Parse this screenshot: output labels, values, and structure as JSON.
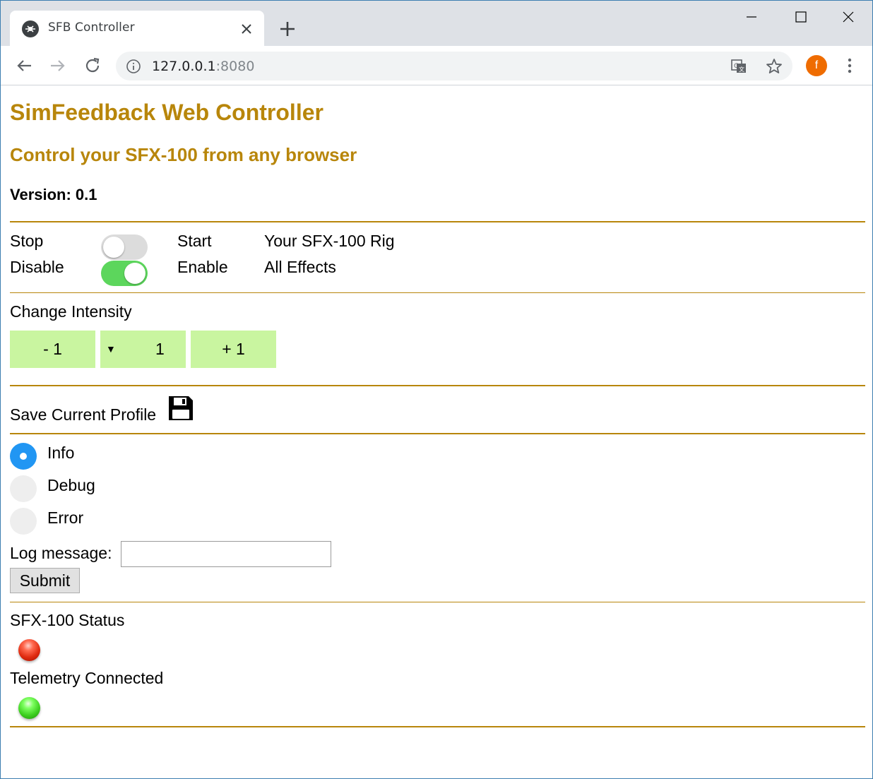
{
  "browser": {
    "tab_title": "SFB Controller",
    "url_host": "127.0.0.1",
    "url_port": ":8080",
    "profile_initial": "f"
  },
  "page": {
    "title": "SimFeedback Web Controller",
    "subtitle": "Control your SFX-100 from any browser",
    "version": "Version: 0.1",
    "rig_row": {
      "off_label": "Stop",
      "on_label": "Start",
      "target": "Your SFX-100 Rig",
      "toggle_on": false
    },
    "effects_row": {
      "off_label": "Disable",
      "on_label": "Enable",
      "target": "All Effects",
      "toggle_on": true
    },
    "intensity": {
      "label": "Change Intensity",
      "decrease_label": "- 1",
      "select_arrow": "▼",
      "selected_value": "1",
      "increase_label": "+ 1"
    },
    "save_profile_label": "Save Current Profile",
    "log_levels": [
      {
        "label": "Info",
        "checked": true
      },
      {
        "label": "Debug",
        "checked": false
      },
      {
        "label": "Error",
        "checked": false
      }
    ],
    "log_message_label": "Log message:",
    "log_message_value": "",
    "submit_label": "Submit",
    "sfx_status_label": "SFX-100 Status",
    "sfx_status_color": "red",
    "telemetry_label": "Telemetry Connected",
    "telemetry_color": "green",
    "accent_color": "#b8860b"
  }
}
